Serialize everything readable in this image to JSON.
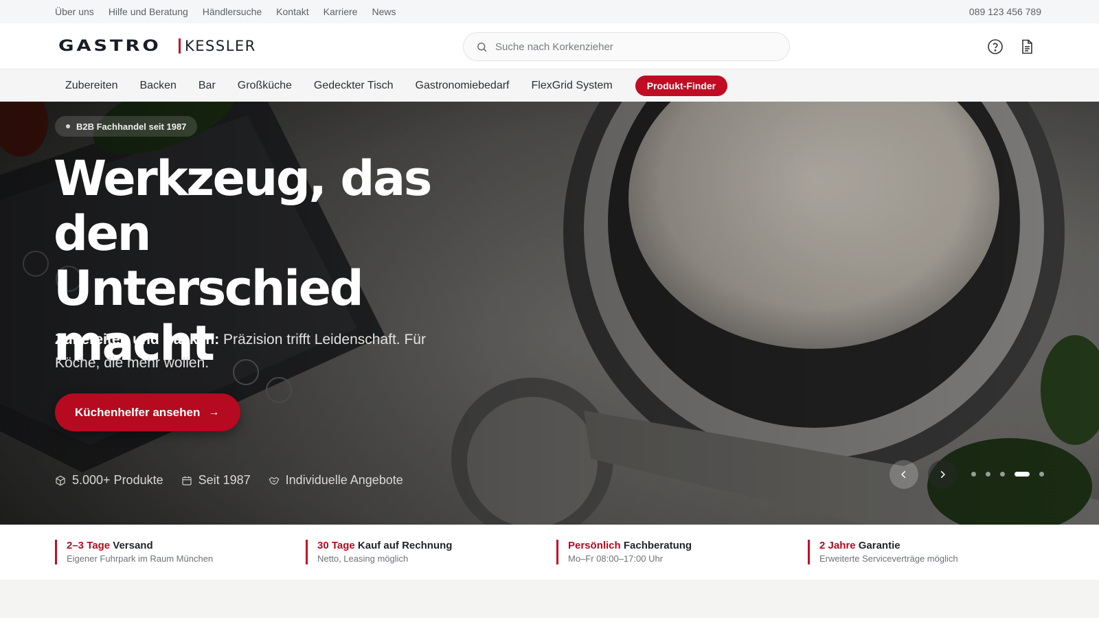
{
  "topbar": {
    "links": [
      "Über uns",
      "Hilfe und Beratung",
      "Händlersuche",
      "Kontakt",
      "Karriere",
      "News"
    ],
    "phone": "089 123 456 789"
  },
  "header": {
    "logo_part1": "GASTRO",
    "logo_part2": "KESSLER",
    "search_placeholder": "Suche nach Korkenzieher",
    "icons": [
      "help-circle-icon",
      "document-icon"
    ]
  },
  "nav": {
    "items": [
      "Zubereiten",
      "Backen",
      "Bar",
      "Großküche",
      "Gedeckter Tisch",
      "Gastronomiebedarf",
      "FlexGrid System"
    ],
    "finder_label": "Produkt-Finder"
  },
  "hero": {
    "badge": "B2B Fachhandel seit 1987",
    "title": "Werkzeug, das den Unterschied macht",
    "subtitle_bold": "Zubereiten und Backen:",
    "subtitle_rest": "Präzision trifft Leidenschaft. Für Köche, die mehr wollen.",
    "cta_label": "Küchenhelfer ansehen",
    "stats": [
      {
        "icon": "box-icon",
        "label": "5.000+ Produkte"
      },
      {
        "icon": "calendar-icon",
        "label": "Seit 1987"
      },
      {
        "icon": "handshake-icon",
        "label": "Individuelle Angebote"
      }
    ],
    "slider": {
      "total": 5,
      "active": 4
    }
  },
  "usps": [
    {
      "highlight": "2–3 Tage",
      "rest": "Versand",
      "sub": "Eigener Fuhrpark im Raum München"
    },
    {
      "highlight": "30 Tage",
      "rest": "Kauf auf Rechnung",
      "sub": "Netto, Leasing möglich"
    },
    {
      "highlight": "Persönlich",
      "rest": "Fachberatung",
      "sub": "Mo–Fr 08:00–17:00 Uhr"
    },
    {
      "highlight": "2 Jahre",
      "rest": "Garantie",
      "sub": "Erweiterte Serviceverträge möglich"
    }
  ],
  "colors": {
    "brand_red": "#c00d23",
    "dark": "#1a1d26"
  }
}
